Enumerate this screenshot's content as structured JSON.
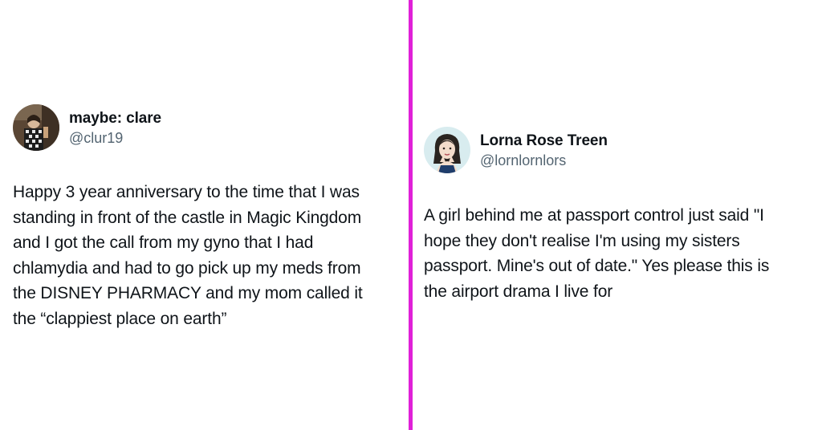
{
  "colors": {
    "divider": "#e020d8",
    "handle": "#536471",
    "text": "#0f1419"
  },
  "tweets": [
    {
      "display_name": "maybe: clare",
      "handle": "@clur19",
      "avatar_icon": "user-avatar-photo",
      "text": "Happy 3 year anniversary to the time that I was\nstanding in front of the castle in Magic Kingdom\nand I got the call from my gyno that I had\nchlamydia and had to go pick up my meds from\nthe DISNEY PHARMACY and my mom called it\nthe “clappiest place on earth”"
    },
    {
      "display_name": "Lorna Rose Treen",
      "handle": "@lornlornlors",
      "avatar_icon": "user-avatar-illustration",
      "text": "A girl behind me at passport control just said \"I\nhope they don't realise I'm using my sisters\npassport. Mine's out of date.\" Yes please this is\nthe airport drama I live for"
    }
  ]
}
